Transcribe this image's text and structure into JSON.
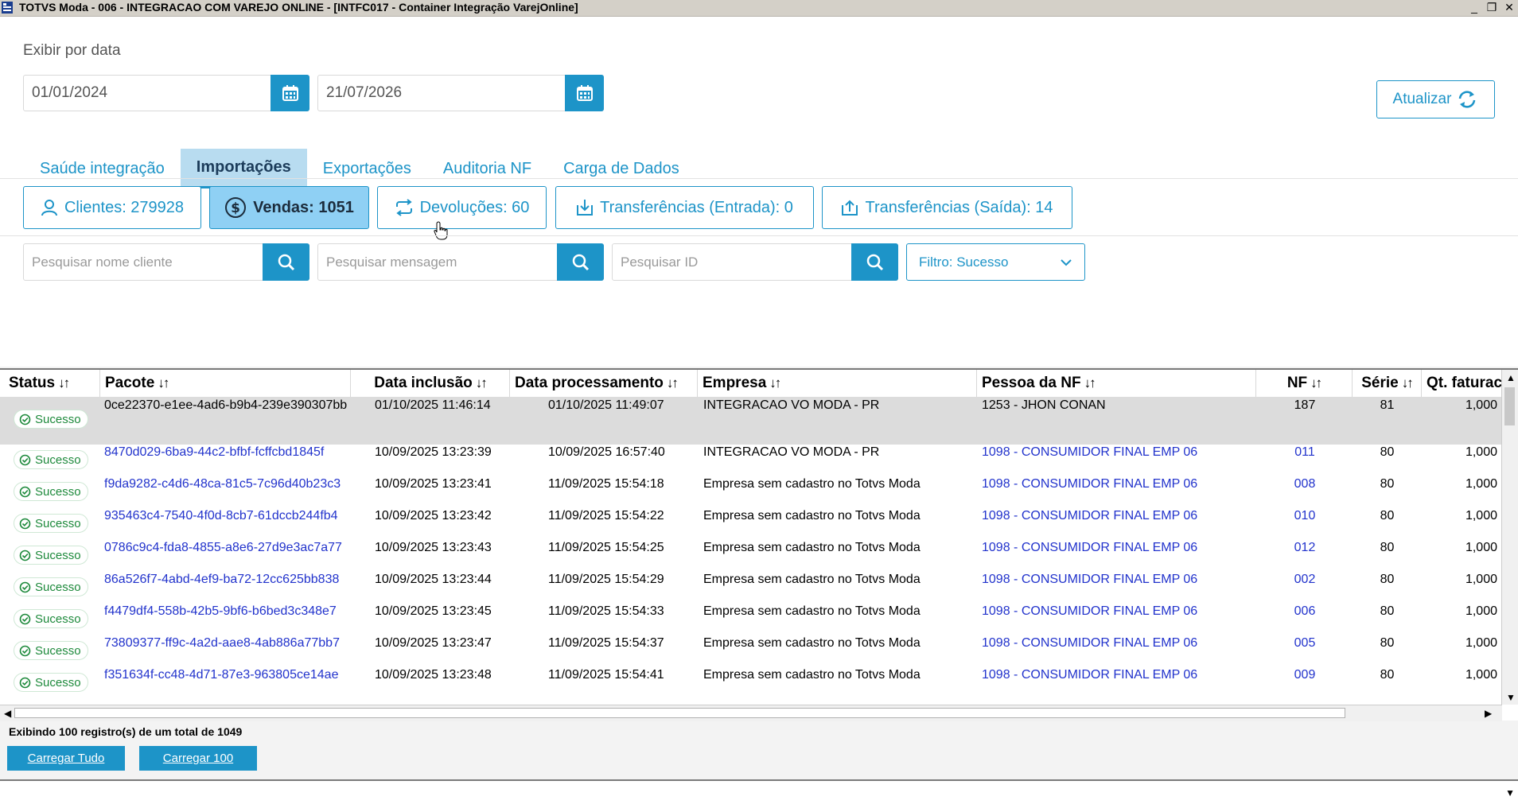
{
  "window": {
    "title": "TOTVS Moda - 006 - INTEGRACAO COM VAREJO ONLINE - [INTFC017 - Container Integração VarejOnline]",
    "minimize": "_",
    "restore": "❐",
    "close": "✕"
  },
  "filters": {
    "date_label": "Exibir por data",
    "date_from": "01/01/2024",
    "date_to": "21/07/2026",
    "refresh_label": "Atualizar"
  },
  "tabs": [
    {
      "label": "Saúde integração"
    },
    {
      "label": "Importações"
    },
    {
      "label": "Exportações"
    },
    {
      "label": "Auditoria NF"
    },
    {
      "label": "Carga de Dados"
    }
  ],
  "counters": {
    "clientes": "Clientes: 279928",
    "vendas": "Vendas: 1051",
    "devolucoes": "Devoluções: 60",
    "transf_entrada": "Transferências (Entrada): 0",
    "transf_saida": "Transferências (Saída): 14"
  },
  "search": {
    "cliente_placeholder": "Pesquisar nome cliente",
    "mensagem_placeholder": "Pesquisar mensagem",
    "id_placeholder": "Pesquisar ID",
    "filter_label": "Filtro: Sucesso"
  },
  "grid": {
    "sort_glyph": "↓↑",
    "columns": {
      "status": "Status",
      "pacote": "Pacote",
      "data_inclusao": "Data inclusão",
      "data_processamento": "Data processamento",
      "empresa": "Empresa",
      "pessoa": "Pessoa da NF",
      "nf": "NF",
      "serie": "Série",
      "qt": "Qt. faturac"
    },
    "rows": [
      {
        "status": "Sucesso",
        "pacote": "0ce22370-e1ee-4ad6-b9b4-239e390307bb",
        "inclusao": "01/10/2025 11:46:14",
        "processamento": "01/10/2025 11:49:07",
        "empresa": "INTEGRACAO VO MODA - PR",
        "pessoa": "1253 - JHON CONAN",
        "nf": "187",
        "serie": "81",
        "qt": "1,000"
      },
      {
        "status": "Sucesso",
        "pacote": "8470d029-6ba9-44c2-bfbf-fcffcbd1845f",
        "inclusao": "10/09/2025 13:23:39",
        "processamento": "10/09/2025 16:57:40",
        "empresa": "INTEGRACAO VO MODA - PR",
        "pessoa": "1098 - CONSUMIDOR FINAL EMP 06",
        "nf": "011",
        "serie": "80",
        "qt": "1,000"
      },
      {
        "status": "Sucesso",
        "pacote": "f9da9282-c4d6-48ca-81c5-7c96d40b23c3",
        "inclusao": "10/09/2025 13:23:41",
        "processamento": "11/09/2025 15:54:18",
        "empresa": "Empresa sem cadastro no Totvs Moda",
        "pessoa": "1098 - CONSUMIDOR FINAL EMP 06",
        "nf": "008",
        "serie": "80",
        "qt": "1,000"
      },
      {
        "status": "Sucesso",
        "pacote": "935463c4-7540-4f0d-8cb7-61dccb244fb4",
        "inclusao": "10/09/2025 13:23:42",
        "processamento": "11/09/2025 15:54:22",
        "empresa": "Empresa sem cadastro no Totvs Moda",
        "pessoa": "1098 - CONSUMIDOR FINAL EMP 06",
        "nf": "010",
        "serie": "80",
        "qt": "1,000"
      },
      {
        "status": "Sucesso",
        "pacote": "0786c9c4-fda8-4855-a8e6-27d9e3ac7a77",
        "inclusao": "10/09/2025 13:23:43",
        "processamento": "11/09/2025 15:54:25",
        "empresa": "Empresa sem cadastro no Totvs Moda",
        "pessoa": "1098 - CONSUMIDOR FINAL EMP 06",
        "nf": "012",
        "serie": "80",
        "qt": "1,000"
      },
      {
        "status": "Sucesso",
        "pacote": "86a526f7-4abd-4ef9-ba72-12cc625bb838",
        "inclusao": "10/09/2025 13:23:44",
        "processamento": "11/09/2025 15:54:29",
        "empresa": "Empresa sem cadastro no Totvs Moda",
        "pessoa": "1098 - CONSUMIDOR FINAL EMP 06",
        "nf": "002",
        "serie": "80",
        "qt": "1,000"
      },
      {
        "status": "Sucesso",
        "pacote": "f4479df4-558b-42b5-9bf6-b6bed3c348e7",
        "inclusao": "10/09/2025 13:23:45",
        "processamento": "11/09/2025 15:54:33",
        "empresa": "Empresa sem cadastro no Totvs Moda",
        "pessoa": "1098 - CONSUMIDOR FINAL EMP 06",
        "nf": "006",
        "serie": "80",
        "qt": "1,000"
      },
      {
        "status": "Sucesso",
        "pacote": "73809377-ff9c-4a2d-aae8-4ab886a77bb7",
        "inclusao": "10/09/2025 13:23:47",
        "processamento": "11/09/2025 15:54:37",
        "empresa": "Empresa sem cadastro no Totvs Moda",
        "pessoa": "1098 - CONSUMIDOR FINAL EMP 06",
        "nf": "005",
        "serie": "80",
        "qt": "1,000"
      },
      {
        "status": "Sucesso",
        "pacote": "f351634f-cc48-4d71-87e3-963805ce14ae",
        "inclusao": "10/09/2025 13:23:48",
        "processamento": "11/09/2025 15:54:41",
        "empresa": "Empresa sem cadastro no Totvs Moda",
        "pessoa": "1098 - CONSUMIDOR FINAL EMP 06",
        "nf": "009",
        "serie": "80",
        "qt": "1,000"
      }
    ]
  },
  "footer": {
    "records_text": "Exibindo 100 registro(s) de um total de 1049",
    "load_all": "Carregar Tudo",
    "load_100": "Carregar 100"
  },
  "colors": {
    "accent": "#1d94c8",
    "success": "#1e8a3c",
    "link": "#2233cc"
  }
}
